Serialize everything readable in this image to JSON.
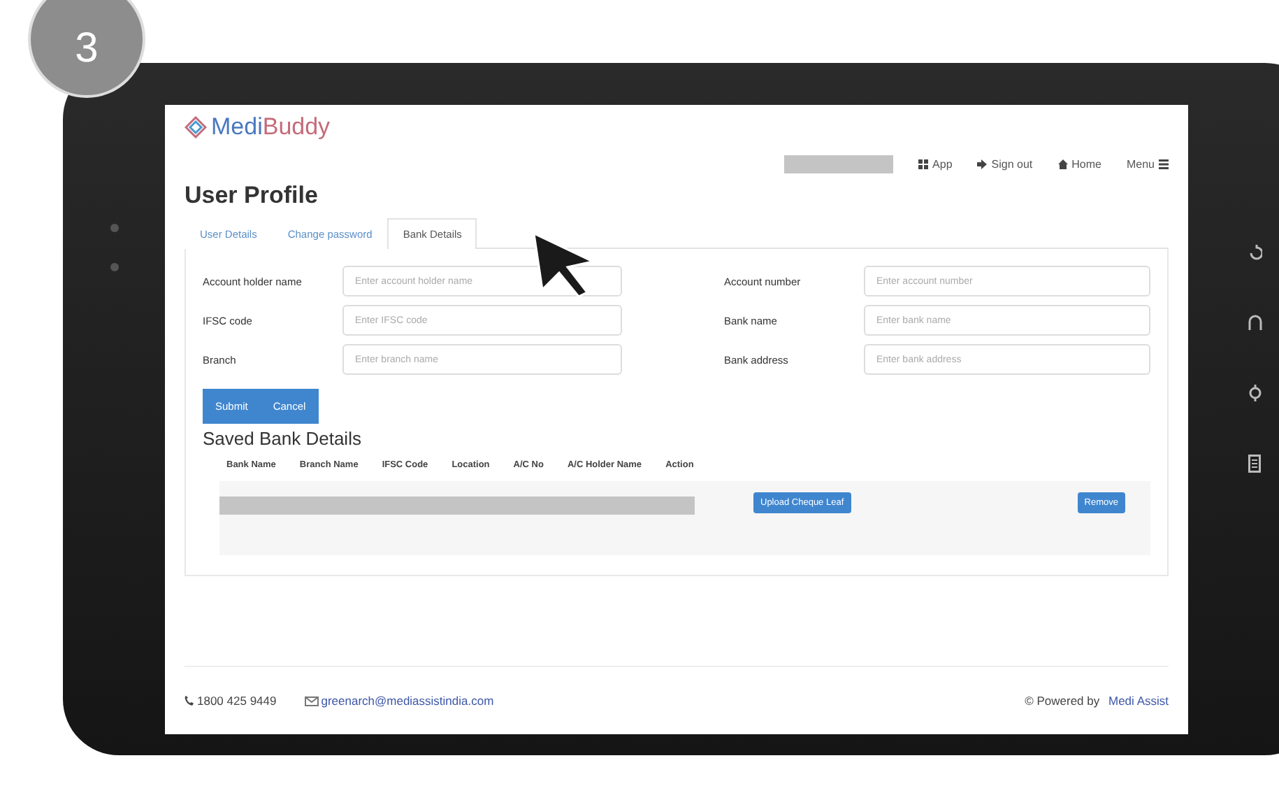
{
  "step_badge": "3",
  "brand": {
    "name_part_1": "Medi",
    "name_part_2": "Buddy"
  },
  "nav": [
    {
      "kind": "app",
      "label": "App"
    },
    {
      "kind": "signout",
      "label": "Sign out"
    },
    {
      "kind": "home",
      "label": "Home"
    },
    {
      "kind": "menu",
      "label": "Menu"
    }
  ],
  "page_title": "User Profile",
  "tabs": [
    {
      "label": "User Details",
      "selected": false
    },
    {
      "label": "Change password",
      "selected": false
    },
    {
      "label": "Bank Details",
      "selected": true
    }
  ],
  "form_fields": [
    {
      "label": "Account holder name",
      "placeholder": "Enter account holder name"
    },
    {
      "label": "Account number",
      "placeholder": "Enter account number"
    },
    {
      "label": "IFSC code",
      "placeholder": "Enter IFSC code"
    },
    {
      "label": "Bank name",
      "placeholder": "Enter bank name"
    },
    {
      "label": "Branch",
      "placeholder": "Enter branch name"
    },
    {
      "label": "Bank address",
      "placeholder": "Enter bank address"
    }
  ],
  "form_buttons": [
    "Submit",
    "Cancel"
  ],
  "saved_title": "Saved Bank Details",
  "table": {
    "columns": [
      "Bank Name",
      "Branch Name",
      "IFSC Code",
      "Location",
      "A/C No",
      "A/C Holder Name",
      "Action"
    ],
    "rows": [
      {
        "upload_button": "Upload Cheque Leaf",
        "remove_button": "Remove"
      }
    ]
  },
  "footer": {
    "phone": "1800 425 9449",
    "email": "greenarch@mediassistindia.com",
    "powered_by": "© Powered by",
    "company": "Medi Assist"
  }
}
